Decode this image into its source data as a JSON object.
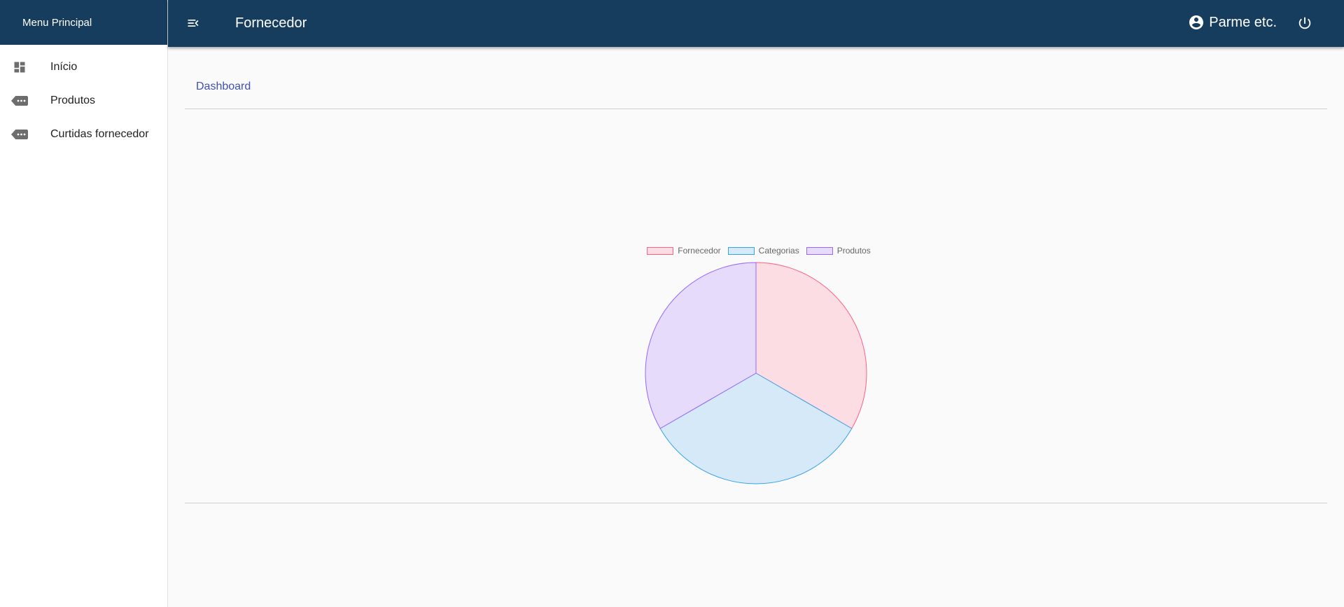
{
  "sidebar": {
    "title": "Menu Principal",
    "items": [
      {
        "label": "Início",
        "icon": "dashboard-icon"
      },
      {
        "label": "Produtos",
        "icon": "label-more-icon"
      },
      {
        "label": "Curtidas fornecedor",
        "icon": "label-more-icon"
      }
    ]
  },
  "header": {
    "title": "Fornecedor",
    "user": "Parme etc.",
    "menu_icon": "menu-open-icon",
    "account_icon": "account-circle-icon",
    "power_icon": "power-icon",
    "background_color": "#173d5e"
  },
  "tabs": [
    {
      "label": "Dashboard",
      "active": true
    }
  ],
  "chart_data": {
    "type": "pie",
    "categories": [
      "Fornecedor",
      "Categorias",
      "Produtos"
    ],
    "values": [
      1,
      1,
      1
    ],
    "colors": {
      "fill": [
        "#fcdde4",
        "#d6e9f8",
        "#e6dbfb"
      ],
      "border": [
        "#ff6384",
        "#36a2eb",
        "#9966ff"
      ]
    },
    "legend": "top"
  }
}
